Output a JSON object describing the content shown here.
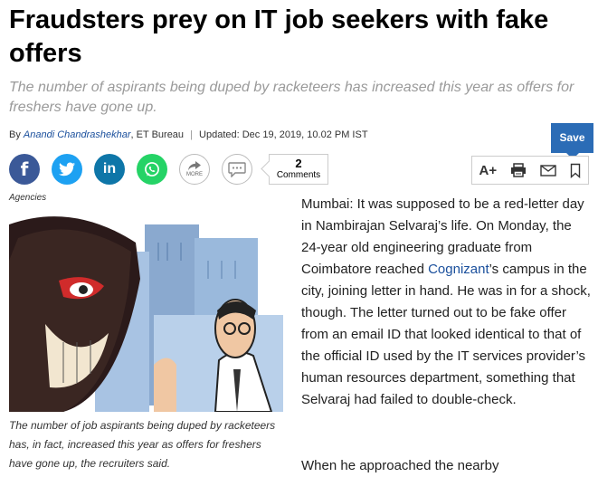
{
  "article": {
    "headline": "Fraudsters prey on IT job seekers with fake offers",
    "summary": "The number of aspirants being duped by racketeers has increased this year as offers for freshers have gone up.",
    "byline": {
      "prefix": "By",
      "author": "Anandi Chandrashekhar",
      "bureau": ", ET Bureau",
      "separator": "|",
      "updated": "Updated: Dec 19, 2019, 10.02 PM IST"
    },
    "save_label": "Save",
    "comments": {
      "count": "2",
      "label": "Comments"
    },
    "more_label": "MORE",
    "font_tool_label": "A+",
    "image_credit": "Agencies",
    "caption": "The number of job aspirants being duped by racketeers has, in fact, increased this year as offers for freshers have gone up, the recruiters said.",
    "body": {
      "p1_before": "Mumbai: It was supposed to be a red-letter day in Nambirajan Selvaraj’s life. On Monday, the 24-year old engineering graduate from Coimbatore reached ",
      "p1_link": "Cognizant",
      "p1_after": "’s campus in the city, joining letter in hand. He was in for a shock, though. The letter turned out to be fake offer from an email ID that looked identical to that of the official ID used by the IT services provider’s human resources department, something that Selvaraj had failed to double-check.",
      "p2": "When he approached the nearby"
    }
  },
  "icons": {
    "share": [
      "facebook-icon",
      "twitter-icon",
      "linkedin-icon",
      "whatsapp-icon",
      "share-more-icon",
      "comment-icon"
    ],
    "tools": [
      "font-size-icon",
      "print-icon",
      "email-icon",
      "bookmark-icon"
    ]
  },
  "colors": {
    "facebook": "#3b5998",
    "twitter": "#1da1f2",
    "linkedin": "#0e76a8",
    "whatsapp": "#25d366",
    "save": "#2b6cb6",
    "link": "#1a4f9c"
  }
}
